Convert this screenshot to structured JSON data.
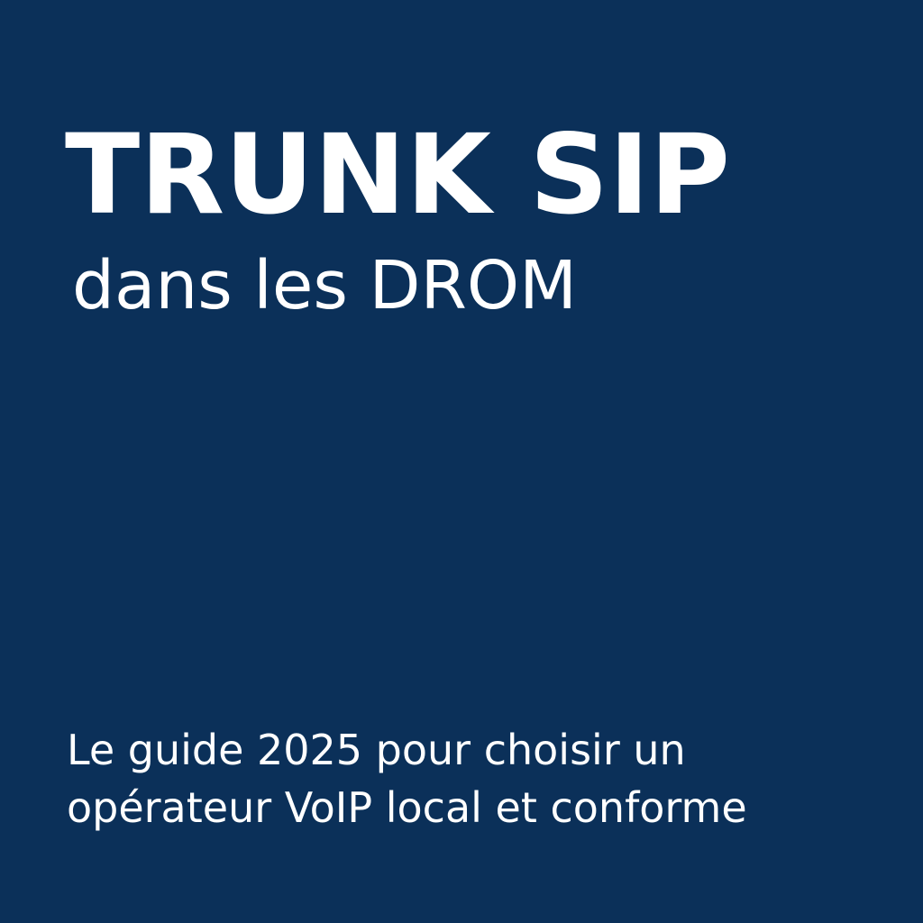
{
  "colors": {
    "background": "#0b3059",
    "text": "#ffffff"
  },
  "heading": {
    "title": "TRUNK SIP",
    "subtitle": "dans les DROM"
  },
  "tagline": {
    "line1": "Le guide 2025 pour choisir un",
    "line2": "opérateur VoIP local et conforme"
  }
}
